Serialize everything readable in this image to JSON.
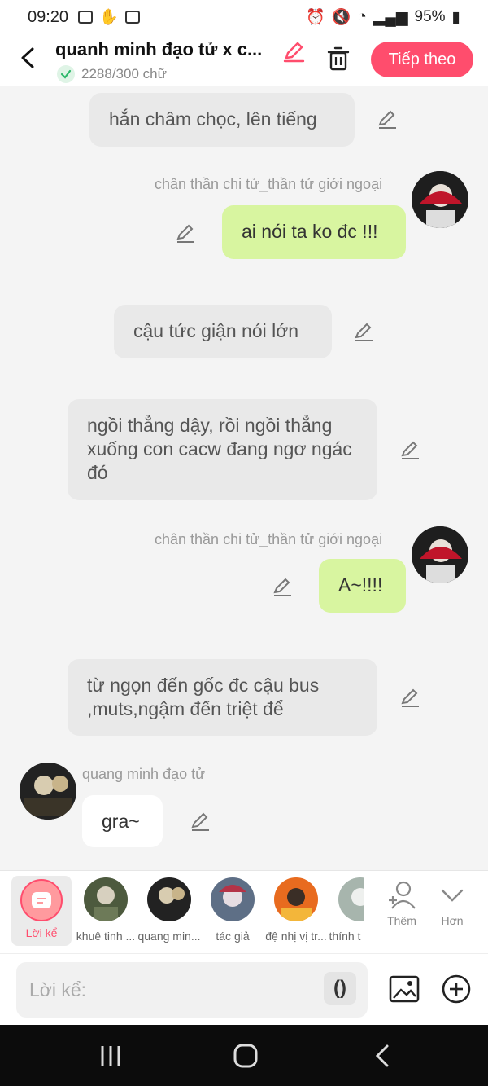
{
  "status": {
    "time": "09:20",
    "battery": "95%"
  },
  "header": {
    "title": "quanh minh đạo tử x c...",
    "word_count": "2288/300 chữ",
    "next_label": "Tiếp theo"
  },
  "messages": [
    {
      "kind": "narration",
      "text": "hắn châm chọc, lên tiếng"
    },
    {
      "kind": "me",
      "name": "chân thần chi tử_thần tử giới ngoại",
      "text": "ai nói ta ko đc !!!"
    },
    {
      "kind": "narration",
      "text": "cậu tức giận nói lớn"
    },
    {
      "kind": "narration",
      "text": "ngồi thẳng dậy, rồi ngồi thẳng xuống con cacw đang ngơ ngác đó"
    },
    {
      "kind": "me",
      "name": "chân thần chi tử_thần tử giới ngoại",
      "text": "A~!!!!"
    },
    {
      "kind": "narration",
      "text": "từ ngọn đến gốc đc cậu bus ,muts,ngậm  đến triệt để"
    },
    {
      "kind": "other",
      "name": "quang minh đạo tử",
      "text": "gra~"
    }
  ],
  "characters": {
    "narrator": "Lời kể",
    "items": [
      "khuê tinh ...",
      "quang min...",
      "tác giả",
      "đệ nhị vị tr...",
      "thính t"
    ],
    "add_label": "Thêm",
    "more_label": "Hơn"
  },
  "input": {
    "placeholder": "Lời kể:",
    "paren": "()"
  },
  "colors": {
    "accent": "#ff4d6d",
    "me_bubble": "#d8f5a0",
    "narration_bubble": "#e9e9e9"
  }
}
